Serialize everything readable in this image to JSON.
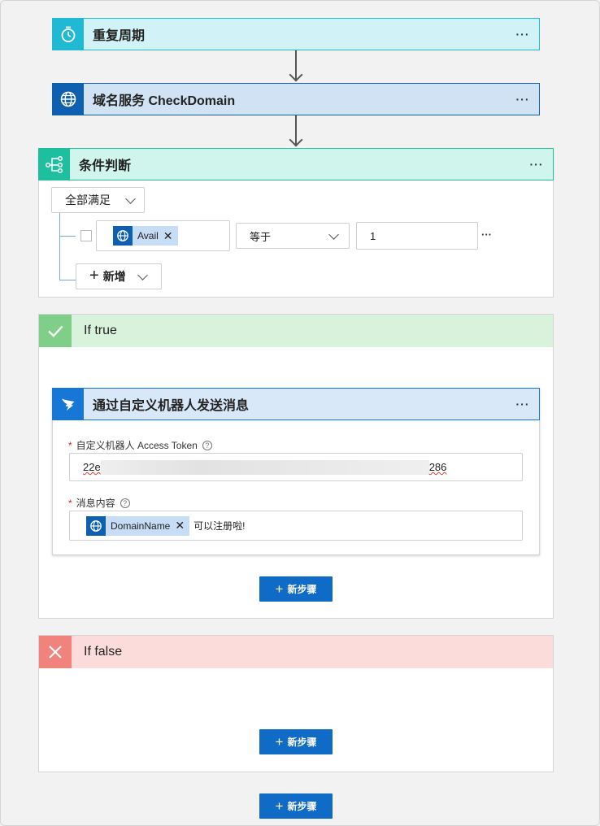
{
  "steps": {
    "recurrence": {
      "title": "重复周期",
      "more": "···"
    },
    "domain": {
      "title": "域名服务 CheckDomain",
      "more": "···"
    },
    "condition": {
      "title": "条件判断",
      "more": "···",
      "match_mode": "全部满足",
      "row": {
        "token": "Avail",
        "operator": "等于",
        "value": "1",
        "more": "···"
      },
      "add_label": "新增"
    }
  },
  "branch_true": {
    "label": "If true",
    "action": {
      "title": "通过自定义机器人发送消息",
      "more": "···",
      "token_label": "自定义机器人 Access Token",
      "token_prefix": "22e",
      "token_suffix": "286",
      "message_label": "消息内容",
      "message_token": "DomainName",
      "message_text": "可以注册啦!"
    },
    "new_step": "新步骤"
  },
  "branch_false": {
    "label": "If false",
    "new_step": "新步骤"
  },
  "footer": {
    "new_step": "新步骤"
  },
  "colors": {
    "recurrence": "#1fb9d4",
    "domain": "#0f5fb0",
    "condition": "#1dbf9f",
    "true": "#7fcf88",
    "false": "#f0837c",
    "action": "#1677d6",
    "primary_button": "#0f6bc6"
  }
}
